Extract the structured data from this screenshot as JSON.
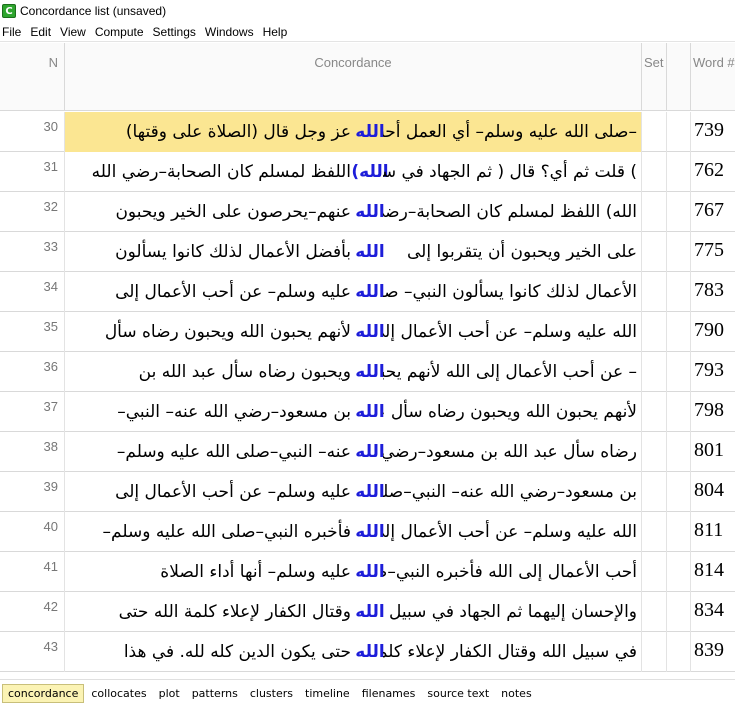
{
  "window": {
    "title": "Concordance list (unsaved)",
    "icon_letter": "C"
  },
  "menu": [
    "File",
    "Edit",
    "View",
    "Compute",
    "Settings",
    "Windows",
    "Help"
  ],
  "columns": {
    "n": "N",
    "concordance": "Concordance",
    "set": "Set",
    "word": "Word #"
  },
  "rows": [
    {
      "n": "30",
      "left": "عز وجل قال (الصلاة على وقتها)",
      "kw": "الله",
      "right": "–صلى الله عليه وسلم– أي العمل أحب",
      "word": "739"
    },
    {
      "n": "31",
      "left": "اللفظ لمسلم كان الصحابة–رضي الله",
      "kw": "الله)",
      "right": ") قلت ثم أي؟ قال ( ثم الجهاد في سبيل",
      "word": "762"
    },
    {
      "n": "32",
      "left": "عنهم–يحرصون على الخير ويحبون",
      "kw": "الله",
      "right": "الله) اللفظ لمسلم كان الصحابة–رضي",
      "word": "767"
    },
    {
      "n": "33",
      "left": "بأفضل الأعمال لذلك كانوا يسألون",
      "kw": "الله",
      "right": "على الخير ويحبون أن يتقربوا إلى",
      "word": "775"
    },
    {
      "n": "34",
      "left": "عليه وسلم– عن أحب الأعمال إلى",
      "kw": "الله",
      "right": "الأعمال لذلك كانوا يسألون النبي– صلى",
      "word": "783"
    },
    {
      "n": "35",
      "left": "لأنهم يحبون الله ويحبون رضاه سأل",
      "kw": "الله",
      "right": "الله عليه وسلم– عن أحب الأعمال إلى",
      "word": "790"
    },
    {
      "n": "36",
      "left": "ويحبون رضاه سأل عبد الله بن",
      "kw": "الله",
      "right": "– عن أحب الأعمال إلى الله لأنهم يحبون",
      "word": "793"
    },
    {
      "n": "37",
      "left": "بن مسعود–رضي الله عنه– النبي–",
      "kw": "الله",
      "right": "لأنهم يحبون الله ويحبون رضاه سأل عبد",
      "word": "798"
    },
    {
      "n": "38",
      "left": "عنه– النبي–صلى الله عليه وسلم–",
      "kw": "الله",
      "right": "رضاه سأل عبد الله بن مسعود–رضي",
      "word": "801"
    },
    {
      "n": "39",
      "left": "عليه وسلم– عن أحب الأعمال إلى",
      "kw": "الله",
      "right": "بن مسعود–رضي الله عنه– النبي–صلى",
      "word": "804"
    },
    {
      "n": "40",
      "left": "فأخبره النبي–صلى الله عليه وسلم–",
      "kw": "الله",
      "right": "الله عليه وسلم– عن أحب الأعمال إلى",
      "word": "811"
    },
    {
      "n": "41",
      "left": "عليه وسلم– أنها أداء الصلاة",
      "kw": "الله",
      "right": "أحب الأعمال إلى الله فأخبره النبي–صلى",
      "word": "814"
    },
    {
      "n": "42",
      "left": "وقتال الكفار لإعلاء كلمة الله حتى",
      "kw": "الله",
      "right": "والإحسان إليهما ثم الجهاد في سبيل",
      "word": "834"
    },
    {
      "n": "43",
      "left": "حتى يكون الدين كله لله. في هذا",
      "kw": "الله",
      "right": "في سبيل الله وقتال الكفار لإعلاء كلمة",
      "word": "839"
    }
  ],
  "selected_row_n": "30",
  "tabs": [
    "concordance",
    "collocates",
    "plot",
    "patterns",
    "clusters",
    "timeline",
    "filenames",
    "source text",
    "notes"
  ],
  "active_tab": "concordance",
  "colors": {
    "keyword": "#1d1dd9",
    "selected_row": "#fbe692",
    "active_tab": "#fbf3b4"
  }
}
